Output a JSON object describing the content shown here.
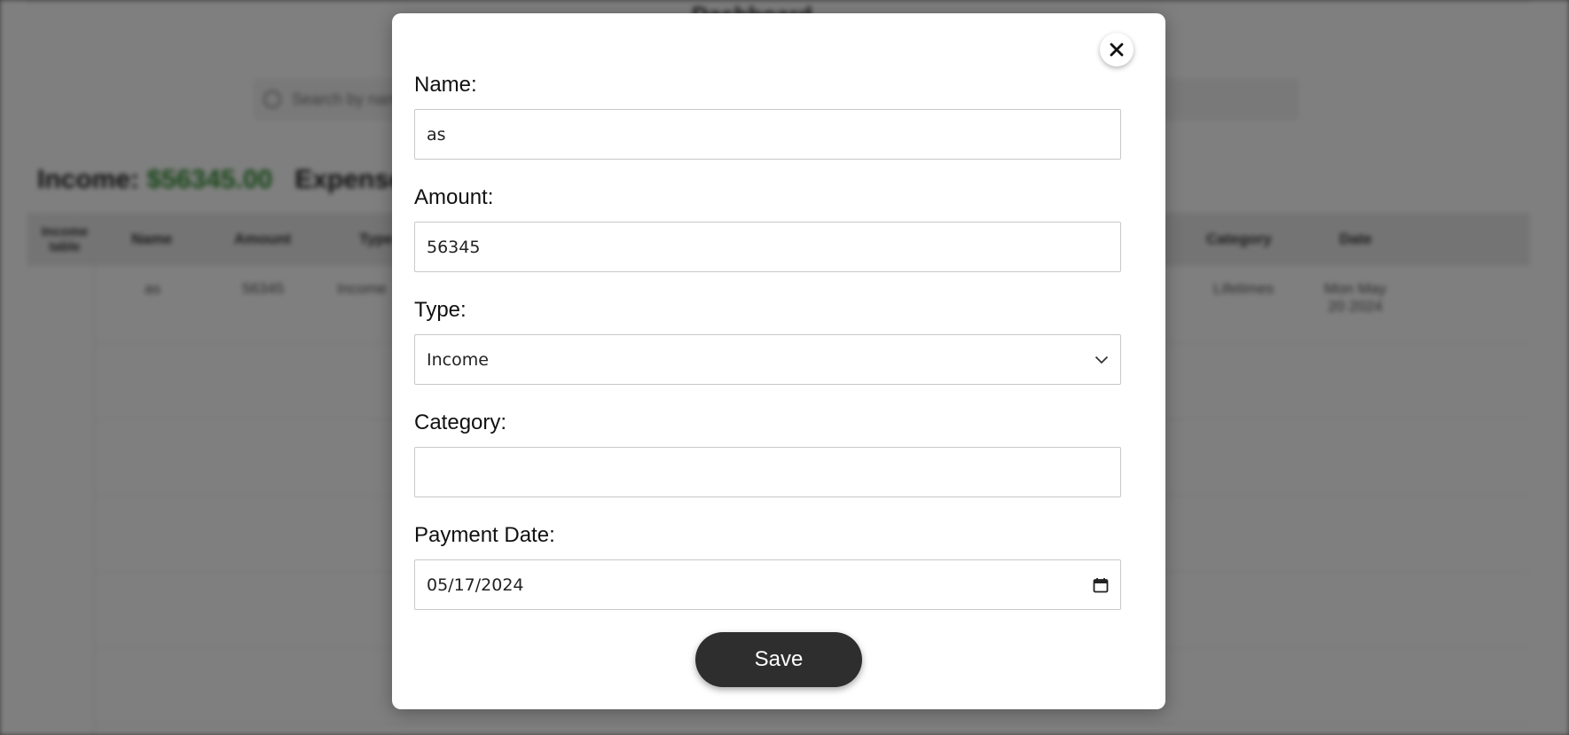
{
  "background": {
    "title": "Dashboard",
    "search_placeholder": "Search by name",
    "summary": {
      "income_label": "Income:",
      "income_value": "$56345.00",
      "expense_label": "Expenses:"
    },
    "table_label": "Income table",
    "columns": [
      "Name",
      "Amount",
      "Type",
      "Category",
      "Date"
    ],
    "first_row": {
      "name": "as",
      "amount": "56345",
      "type": "Income",
      "category": "Lifetimes",
      "date": "Mon May 20 2024"
    }
  },
  "modal": {
    "close_icon": "close-icon",
    "name": {
      "label": "Name:",
      "value": "as"
    },
    "amount": {
      "label": "Amount:",
      "value": "56345"
    },
    "type": {
      "label": "Type:",
      "selected": "Income"
    },
    "category": {
      "label": "Category:",
      "value": ""
    },
    "payment_date": {
      "label": "Payment Date:",
      "value": "05/17/2024"
    },
    "save_label": "Save"
  }
}
